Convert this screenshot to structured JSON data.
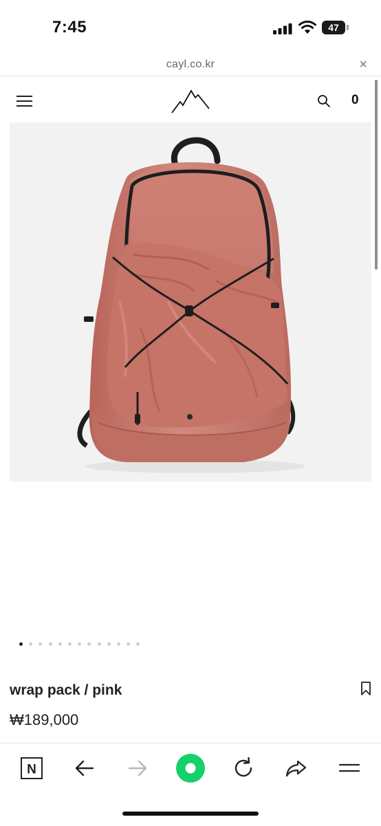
{
  "status_bar": {
    "time": "7:45",
    "battery_level": "47",
    "icons": [
      "signal-icon",
      "wifi-icon",
      "battery-icon"
    ]
  },
  "browser": {
    "url": "cayl.co.kr",
    "close_glyph": "×"
  },
  "header": {
    "menu_icon": "hamburger-menu-icon",
    "logo_icon": "mountain-logo-icon",
    "search_icon": "search-icon",
    "cart_count": "0"
  },
  "product": {
    "name": "wrap pack / pink",
    "price": "₩189,000",
    "bookmark_icon": "bookmark-icon",
    "image_colors": {
      "body": "#c8786c",
      "shadow": "#a9584f",
      "highlight": "#dc958a",
      "trim": "#1e1e1e"
    }
  },
  "carousel": {
    "total": 13,
    "active_index": 0
  },
  "toolbar": {
    "items": [
      {
        "icon": "naver-n-icon",
        "label": "N"
      },
      {
        "icon": "back-arrow-icon"
      },
      {
        "icon": "forward-arrow-icon"
      },
      {
        "icon": "green-dot-icon",
        "color": "#16d16a"
      },
      {
        "icon": "refresh-icon"
      },
      {
        "icon": "share-icon"
      },
      {
        "icon": "menu-icon"
      }
    ]
  }
}
